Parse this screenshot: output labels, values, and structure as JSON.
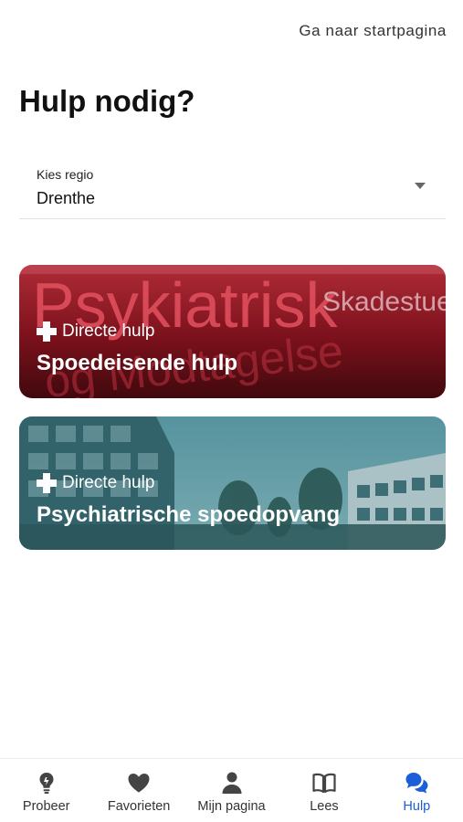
{
  "header": {
    "home_link": "Ga naar startpagina"
  },
  "page_title": "Hulp nodig?",
  "region": {
    "label": "Kies regio",
    "value": "Drenthe"
  },
  "cards": [
    {
      "kicker": "Directe hulp",
      "title": "Spoedeisende hulp",
      "image_sign_line1": "Psykiatrisk",
      "image_sign_line1b": "Skadestue",
      "image_sign_line2": "og Modtagelse",
      "tint": "#b01a2a"
    },
    {
      "kicker": "Directe hulp",
      "title": "Psychiatrische spoedopvang",
      "tint": "#2f6f78"
    }
  ],
  "tabbar": {
    "items": [
      {
        "label": "Probeer",
        "icon": "lightbulb-icon",
        "active": false
      },
      {
        "label": "Favorieten",
        "icon": "heart-icon",
        "active": false
      },
      {
        "label": "Mijn pagina",
        "icon": "person-icon",
        "active": false
      },
      {
        "label": "Lees",
        "icon": "book-icon",
        "active": false
      },
      {
        "label": "Hulp",
        "icon": "chat-bubbles-icon",
        "active": true
      }
    ],
    "active_color": "#1a5ed8"
  }
}
